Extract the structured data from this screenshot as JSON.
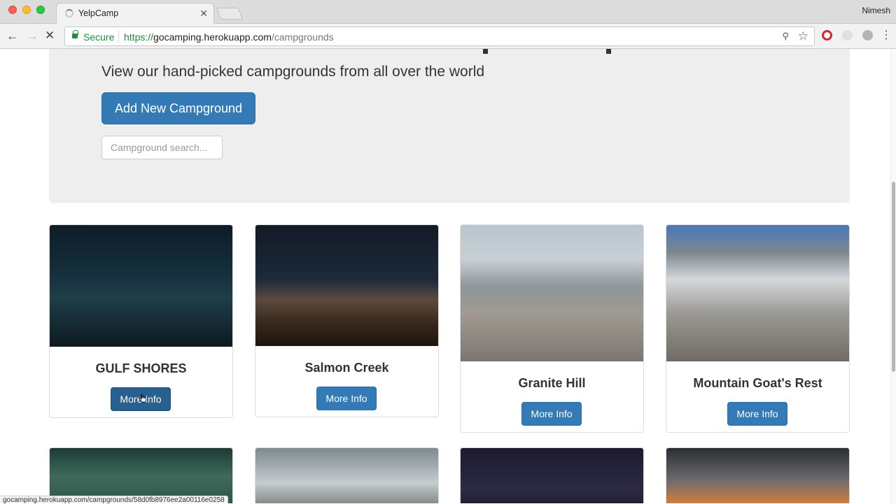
{
  "browser": {
    "tab_title": "YelpCamp",
    "profile_name": "Nimesh",
    "secure_label": "Secure",
    "url_scheme": "https://",
    "url_host": "gocamping.herokuapp.com",
    "url_path": "/campgrounds",
    "status_url": "gocamping.herokuapp.com/campgrounds/58d0fb8976ee2a00116e0258"
  },
  "jumbotron": {
    "lead": "View our hand-picked campgrounds from all over the world",
    "add_button": "Add New Campground",
    "search_placeholder": "Campground search..."
  },
  "campgrounds": [
    {
      "name": "GULF SHORES",
      "button": "More Info"
    },
    {
      "name": "Salmon Creek",
      "button": "More Info"
    },
    {
      "name": "Granite Hill",
      "button": "More Info"
    },
    {
      "name": "Mountain Goat's Rest",
      "button": "More Info"
    }
  ],
  "colors": {
    "primary": "#337ab7",
    "primary_active": "#286090",
    "jumbotron_bg": "#eeeeee",
    "secure_green": "#1f8e3a"
  },
  "icons": [
    "back-icon",
    "forward-icon",
    "stop-icon",
    "lock-icon",
    "key-icon",
    "star-icon",
    "opera-icon",
    "extension-icon",
    "menu-icon",
    "cursor-icon"
  ]
}
